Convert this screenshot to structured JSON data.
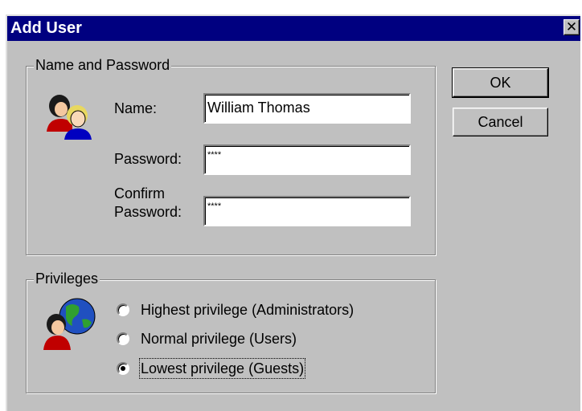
{
  "window": {
    "title": "Add User",
    "close_glyph": "✕"
  },
  "name_password": {
    "legend": "Name and Password",
    "icon": "users-icon",
    "name_label": "Name:",
    "name_value": "William Thomas",
    "password_label": "Password:",
    "password_value": "****",
    "confirm_label_line1": "Confirm",
    "confirm_label_line2": "Password:",
    "confirm_value": "****"
  },
  "privileges": {
    "legend": "Privileges",
    "icon": "globe-user-icon",
    "options": [
      {
        "label": "Highest privilege (Administrators)",
        "selected": false
      },
      {
        "label": "Normal privilege (Users)",
        "selected": false
      },
      {
        "label": "Lowest privilege (Guests)",
        "selected": true
      }
    ]
  },
  "buttons": {
    "ok": "OK",
    "cancel": "Cancel"
  },
  "colors": {
    "titlebar": "#000080",
    "face": "#c0c0c0"
  }
}
